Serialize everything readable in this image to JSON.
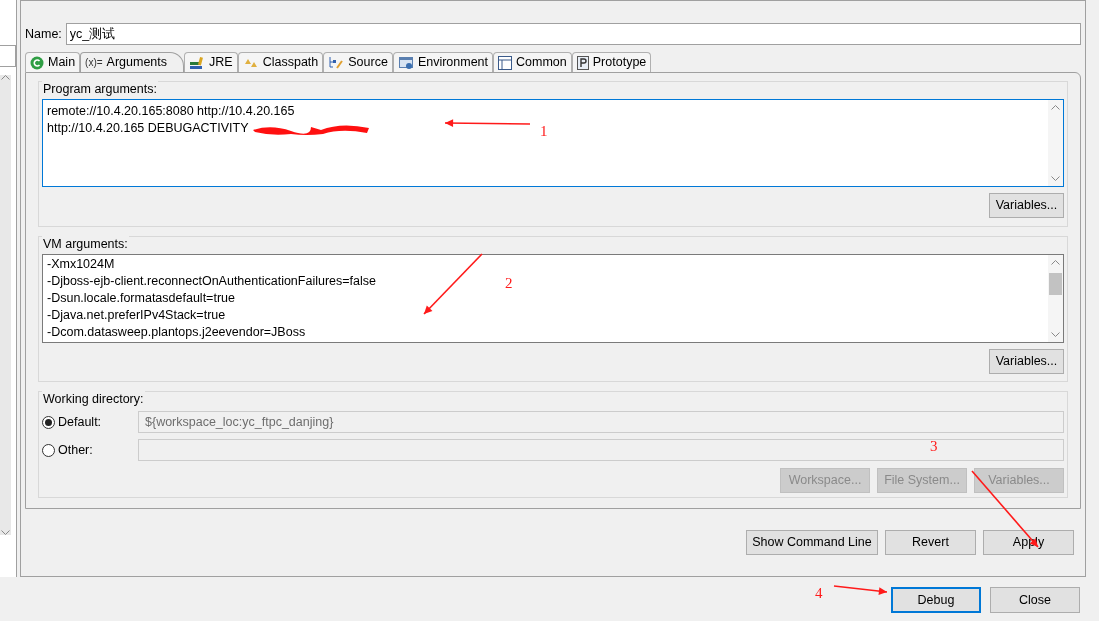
{
  "name_field": {
    "label": "Name:",
    "value": "yc_测试"
  },
  "tabs": [
    {
      "label": "Main",
      "selected": false
    },
    {
      "label": "Arguments",
      "icon_text": "(x)=",
      "selected": true
    },
    {
      "label": "JRE",
      "selected": false
    },
    {
      "label": "Classpath",
      "selected": false
    },
    {
      "label": "Source",
      "selected": false
    },
    {
      "label": "Environment",
      "selected": false
    },
    {
      "label": "Common",
      "selected": false
    },
    {
      "label": "Prototype",
      "selected": false
    }
  ],
  "program_arguments": {
    "label": "Program arguments:",
    "lines": [
      "remote://10.4.20.165:8080  http://10.4.20.165",
      "http://10.4.20.165 DEBUGACTIVITY"
    ],
    "redacted": true,
    "button": "Variables..."
  },
  "vm_arguments": {
    "label": "VM arguments:",
    "lines": [
      "-Xmx1024M",
      "-Djboss-ejb-client.reconnectOnAuthenticationFailures=false",
      "-Dsun.locale.formatasdefault=true",
      "-Djava.net.preferIPv4Stack=true",
      "-Dcom.datasweep.plantops.j2eevendor=JBoss"
    ],
    "button": "Variables..."
  },
  "working_directory": {
    "label": "Working directory:",
    "options": [
      {
        "label": "Default:",
        "value": "${workspace_loc:yc_ftpc_danjing}",
        "selected": true
      },
      {
        "label": "Other:",
        "selected": false
      }
    ],
    "buttons": [
      {
        "label": "Workspace...",
        "disabled": true
      },
      {
        "label": "File System...",
        "disabled": true
      },
      {
        "label": "Variables...",
        "disabled": true
      }
    ]
  },
  "panel_buttons": [
    "Show Command Line",
    "Revert",
    "Apply"
  ],
  "dialog_buttons": [
    {
      "label": "Debug",
      "default": true
    },
    {
      "label": "Close",
      "default": false
    }
  ],
  "annotations": [
    "1",
    "2",
    "3",
    "4"
  ]
}
